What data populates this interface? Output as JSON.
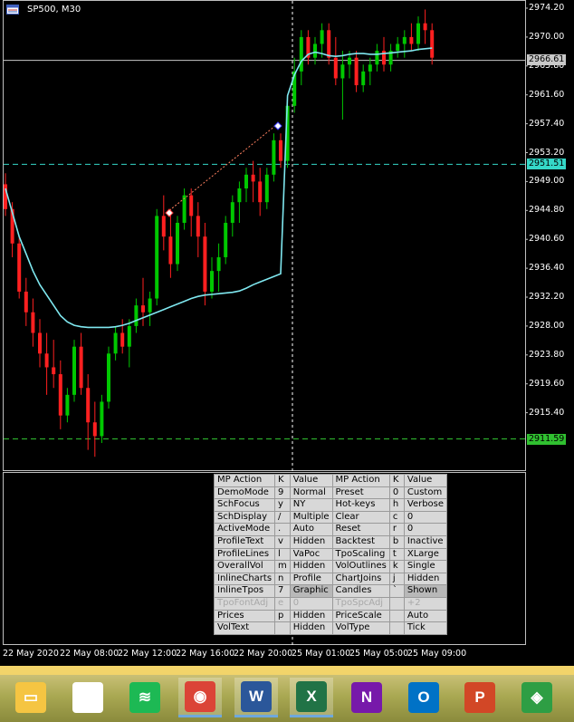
{
  "window": {
    "symbol_label": "SP500, M30"
  },
  "chart": {
    "type": "candlestick",
    "symbol": "SP500",
    "timeframe": "M30",
    "y_range": [
      2911.59,
      2974.2
    ],
    "price_ticks": [
      "2974.20",
      "2970.00",
      "2965.80",
      "2961.60",
      "2957.40",
      "2953.20",
      "2949.00",
      "2944.80",
      "2940.60",
      "2936.40",
      "2932.20",
      "2928.00",
      "2923.80",
      "2919.60",
      "2915.40"
    ],
    "current_price_label": "2966.61",
    "upper_level_label": "2951.51",
    "lower_level_label": "2911.59",
    "time_ticks": [
      "22 May 2020",
      "22 May 08:00",
      "22 May 12:00",
      "22 May 16:00",
      "22 May 20:00",
      "25 May 01:00",
      "25 May 05:00",
      "25 May 09:00"
    ],
    "colors": {
      "bull": "#00c800",
      "bear": "#ff2020",
      "vwap": "#7fe8f0",
      "level": "#35d8c8",
      "lower_level": "#30c030",
      "current": "#c8c8c8"
    },
    "candles": [
      [
        2948.6,
        2950.2,
        2944.0,
        2945.0
      ],
      [
        2945.0,
        2946.0,
        2938.0,
        2940.0
      ],
      [
        2940.0,
        2941.0,
        2932.0,
        2933.0
      ],
      [
        2933.0,
        2935.0,
        2928.0,
        2930.0
      ],
      [
        2930.0,
        2932.0,
        2925.0,
        2927.0
      ],
      [
        2927.0,
        2929.0,
        2922.0,
        2924.0
      ],
      [
        2924.0,
        2927.0,
        2918.0,
        2922.0
      ],
      [
        2922.0,
        2926.0,
        2919.0,
        2921.0
      ],
      [
        2921.0,
        2923.0,
        2913.0,
        2915.0
      ],
      [
        2915.0,
        2919.0,
        2914.0,
        2918.0
      ],
      [
        2918.0,
        2926.0,
        2917.0,
        2925.0
      ],
      [
        2925.0,
        2927.0,
        2918.0,
        2919.0
      ],
      [
        2919.0,
        2921.0,
        2910.0,
        2914.0
      ],
      [
        2914.0,
        2917.0,
        2909.0,
        2912.0
      ],
      [
        2912.0,
        2918.0,
        2911.0,
        2917.0
      ],
      [
        2917.0,
        2925.0,
        2916.0,
        2924.0
      ],
      [
        2924.0,
        2928.0,
        2923.0,
        2927.0
      ],
      [
        2927.0,
        2929.0,
        2924.0,
        2925.0
      ],
      [
        2925.0,
        2929.0,
        2922.0,
        2928.0
      ],
      [
        2928.0,
        2932.0,
        2927.0,
        2931.0
      ],
      [
        2931.0,
        2935.0,
        2928.0,
        2930.0
      ],
      [
        2930.0,
        2933.0,
        2928.0,
        2932.0
      ],
      [
        2932.0,
        2945.0,
        2931.0,
        2944.0
      ],
      [
        2944.0,
        2947.0,
        2939.0,
        2941.0
      ],
      [
        2941.0,
        2945.0,
        2935.0,
        2937.0
      ],
      [
        2937.0,
        2944.0,
        2936.0,
        2943.0
      ],
      [
        2943.0,
        2948.0,
        2942.0,
        2947.0
      ],
      [
        2947.0,
        2948.0,
        2941.0,
        2944.0
      ],
      [
        2944.0,
        2946.0,
        2938.0,
        2941.0
      ],
      [
        2941.0,
        2943.0,
        2931.0,
        2933.0
      ],
      [
        2933.0,
        2938.0,
        2932.0,
        2936.0
      ],
      [
        2936.0,
        2940.0,
        2933.0,
        2938.0
      ],
      [
        2938.0,
        2944.0,
        2937.0,
        2943.0
      ],
      [
        2943.0,
        2947.0,
        2941.0,
        2946.0
      ],
      [
        2946.0,
        2949.0,
        2943.0,
        2948.0
      ],
      [
        2948.0,
        2951.0,
        2946.0,
        2950.0
      ],
      [
        2950.0,
        2952.0,
        2946.0,
        2949.0
      ],
      [
        2949.0,
        2951.0,
        2944.0,
        2946.0
      ],
      [
        2946.0,
        2951.0,
        2945.0,
        2950.0
      ],
      [
        2950.0,
        2956.0,
        2949.0,
        2955.0
      ],
      [
        2955.0,
        2956.0,
        2951.0,
        2952.0
      ],
      [
        2952.0,
        2961.0,
        2951.0,
        2960.0
      ],
      [
        2960.0,
        2967.0,
        2959.0,
        2965.0
      ],
      [
        2965.0,
        2971.0,
        2963.0,
        2970.0
      ],
      [
        2970.0,
        2971.0,
        2966.0,
        2967.0
      ],
      [
        2967.0,
        2970.0,
        2966.0,
        2969.0
      ],
      [
        2969.0,
        2972.0,
        2967.0,
        2971.0
      ],
      [
        2971.0,
        2972.0,
        2966.0,
        2967.0
      ],
      [
        2967.0,
        2970.0,
        2963.0,
        2964.0
      ],
      [
        2964.0,
        2968.0,
        2958.0,
        2966.0
      ],
      [
        2966.0,
        2968.0,
        2964.0,
        2967.0
      ],
      [
        2967.0,
        2968.0,
        2962.0,
        2963.0
      ],
      [
        2963.0,
        2966.0,
        2962.0,
        2965.0
      ],
      [
        2965.0,
        2967.0,
        2963.0,
        2966.0
      ],
      [
        2966.0,
        2969.0,
        2965.0,
        2968.0
      ],
      [
        2968.0,
        2970.0,
        2965.0,
        2966.0
      ],
      [
        2966.0,
        2969.0,
        2965.0,
        2968.0
      ],
      [
        2968.0,
        2970.0,
        2967.0,
        2969.0
      ],
      [
        2969.0,
        2971.0,
        2967.0,
        2970.0
      ],
      [
        2970.0,
        2972.0,
        2968.0,
        2969.0
      ],
      [
        2969.0,
        2973.0,
        2968.0,
        2972.0
      ],
      [
        2972.0,
        2974.0,
        2969.0,
        2971.0
      ],
      [
        2971.0,
        2972.0,
        2966.0,
        2967.0
      ]
    ],
    "vwap": [
      2948.0,
      2944.5,
      2941.0,
      2938.5,
      2936.0,
      2934.0,
      2932.5,
      2931.0,
      2929.5,
      2928.6,
      2928.1,
      2927.9,
      2927.8,
      2927.8,
      2927.8,
      2927.8,
      2927.9,
      2928.1,
      2928.4,
      2928.8,
      2929.2,
      2929.6,
      2930.0,
      2930.4,
      2930.8,
      2931.2,
      2931.6,
      2932.0,
      2932.3,
      2932.5,
      2932.6,
      2932.7,
      2932.8,
      2932.9,
      2933.1,
      2933.5,
      2934.0,
      2934.4,
      2934.8,
      2935.2,
      2935.6,
      2961.5,
      2964.5,
      2966.5,
      2967.5,
      2967.8,
      2967.6,
      2967.3,
      2967.2,
      2967.3,
      2967.5,
      2967.6,
      2967.6,
      2967.5,
      2967.5,
      2967.6,
      2967.7,
      2967.8,
      2967.9,
      2968.0,
      2968.2,
      2968.3,
      2968.4
    ]
  },
  "settings_panel": {
    "headers": [
      "MP Action",
      "K",
      "Value",
      "MP Action",
      "K",
      "Value"
    ],
    "rows": [
      [
        "DemoMode",
        "9",
        "Normal",
        "Preset",
        "0",
        "Custom"
      ],
      [
        "SchFocus",
        "y",
        "NY",
        "Hot-keys",
        "h",
        "Verbose"
      ],
      [
        "SchDisplay",
        "/",
        "Multiple",
        "Clear",
        "c",
        "0"
      ],
      [
        "ActiveMode",
        ".",
        "Auto",
        "Reset",
        "r",
        "0"
      ],
      [
        "ProfileText",
        "v",
        "Hidden",
        "Backtest",
        "b",
        "Inactive"
      ],
      [
        "ProfileLines",
        "l",
        "VaPoc",
        "TpoScaling",
        "t",
        "XLarge"
      ],
      [
        "OverallVol",
        "m",
        "Hidden",
        "VolOutlines",
        "k",
        "Single"
      ],
      [
        "InlineCharts",
        "n",
        "Profile",
        "ChartJoins",
        "j",
        "Hidden"
      ],
      [
        "InlineTpos",
        "7",
        "Graphic",
        "Candles",
        "`",
        "Shown"
      ],
      [
        "TpoFontAdj",
        "e",
        "0",
        "TpoSpcAdj",
        "",
        "+2"
      ],
      [
        "Prices",
        "p",
        "Hidden",
        "PriceScale",
        "",
        "Auto"
      ],
      [
        "VolText",
        "",
        "Hidden",
        "VolType",
        "",
        "Tick"
      ]
    ]
  },
  "taskbar": {
    "apps": [
      {
        "name": "file-explorer-icon",
        "glyph": "▭",
        "color": "#f5c542"
      },
      {
        "name": "home-icon",
        "glyph": "⌂",
        "color": "#ffffff"
      },
      {
        "name": "spotify-icon",
        "glyph": "≋",
        "color": "#1db954"
      },
      {
        "name": "chrome-icon",
        "glyph": "◉",
        "color": "#db4437"
      },
      {
        "name": "word-icon",
        "glyph": "W",
        "color": "#2b579a"
      },
      {
        "name": "excel-icon",
        "glyph": "X",
        "color": "#217346"
      },
      {
        "name": "onenote-icon",
        "glyph": "N",
        "color": "#7719aa"
      },
      {
        "name": "outlook-icon",
        "glyph": "O",
        "color": "#0072c6"
      },
      {
        "name": "powerpoint-icon",
        "glyph": "P",
        "color": "#d24726"
      },
      {
        "name": "metatrader-icon",
        "glyph": "◈",
        "color": "#2e9e44"
      }
    ]
  }
}
